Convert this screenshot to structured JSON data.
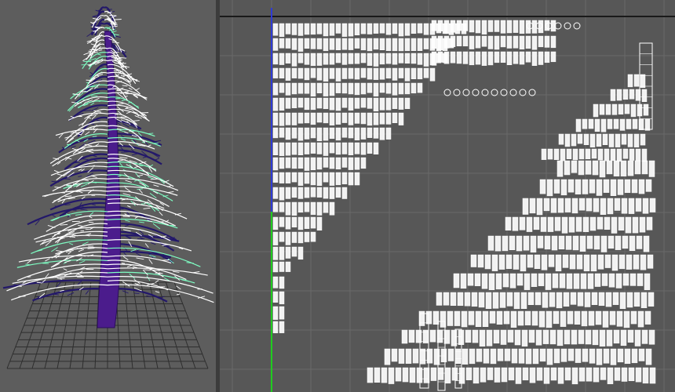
{
  "viewports": {
    "perspective": {
      "name": "perspective-viewport",
      "content": "pine-tree-model"
    },
    "uv_editor": {
      "name": "uv-texture-editor",
      "content": "uv-shells"
    }
  },
  "colors": {
    "viewport_bg": "#5d5d5d",
    "uv_bg": "#575757",
    "grid_line": "#6a6a6a",
    "wireframe": "#ffffff",
    "selected_wire": "#7fffc4",
    "trunk": "#4b1c8c",
    "axis_v": "#2f3bd6",
    "axis_v_lower": "#1fcc1f",
    "uv_top_border": "#1a1a1a"
  },
  "icons": [
    "pine-tree-icon",
    "ground-grid-icon",
    "uv-shell-icon"
  ]
}
